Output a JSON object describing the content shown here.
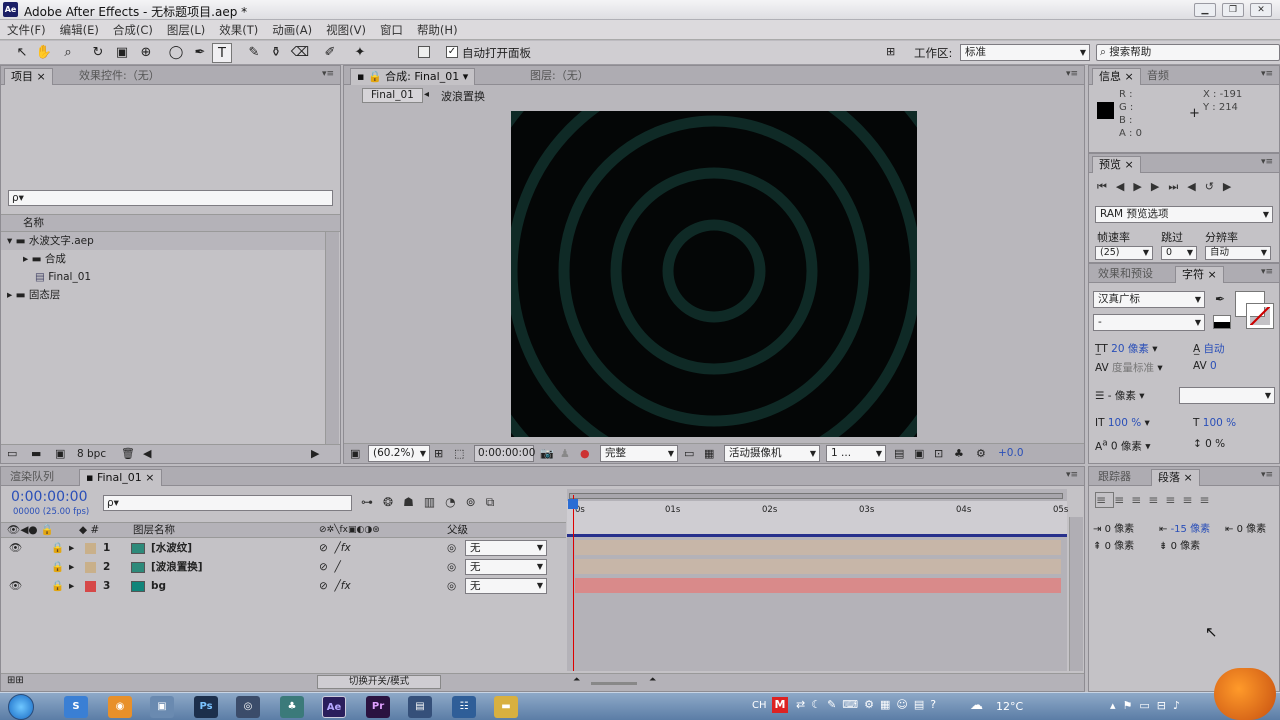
{
  "window": {
    "title": "Adobe After Effects - 无标题项目.aep *",
    "app_badge": "Ae"
  },
  "menu": [
    "文件(F)",
    "编辑(E)",
    "合成(C)",
    "图层(L)",
    "效果(T)",
    "动画(A)",
    "视图(V)",
    "窗口",
    "帮助(H)"
  ],
  "toolbar": {
    "auto_open_label": "自动打开面板",
    "workspace_label": "工作区:",
    "workspace_value": "标准",
    "search_placeholder": "搜索帮助"
  },
  "project": {
    "tab_project": "项目",
    "tab_effects": "效果控件:（无）",
    "search_placeholder": "ρ▾",
    "col_name": "名称",
    "bpc": "8 bpc",
    "items": [
      {
        "label": "水波文字.aep",
        "type": "folder"
      },
      {
        "label": "合成",
        "type": "folder"
      },
      {
        "label": "Final_01",
        "type": "comp"
      },
      {
        "label": "固态层",
        "type": "folder"
      }
    ]
  },
  "composition": {
    "tab_comp": "合成: Final_01",
    "tab_layer": "图层:（无）",
    "crumb_active": "Final_01",
    "crumb_next": "波浪置换",
    "zoom": "(60.2%)",
    "timecode": "0:00:00:00",
    "resolution": "完整",
    "camera": "活动摄像机",
    "views": "1 ...",
    "exposure": "+0.0"
  },
  "info": {
    "tab_info": "信息",
    "tab_audio": "音频",
    "r": "R :",
    "g": "G :",
    "b": "B :",
    "a": "A : 0",
    "x": "X : -191",
    "y": "Y : 214"
  },
  "preview": {
    "tab": "预览",
    "ram_option": "RAM 预览选项",
    "frame_rate_label": "帧速率",
    "skip_label": "跳过",
    "resolution_label": "分辨率",
    "frame_rate": "(25)",
    "skip": "0",
    "resolution": "自动"
  },
  "character": {
    "tab_effects": "效果和预设",
    "tab_char": "字符",
    "font": "汉真广标",
    "style": "-",
    "size": "20 像素",
    "leading": "自动",
    "kerning": "度量标准",
    "tracking": "0",
    "stroke": "- 像素",
    "v_scale": "100 %",
    "h_scale": "100 %",
    "baseline": "0 像素",
    "tsume": "0 %"
  },
  "paragraph": {
    "tab_tracker": "跟踪器",
    "tab_para": "段落",
    "indent_left": "0 像素",
    "indent_first": "-15 像素",
    "indent_right": "0 像素",
    "space_before": "0 像素",
    "space_after": "0 像素"
  },
  "timeline": {
    "tab_render": "渲染队列",
    "tab_comp": "Final_01",
    "timecode": "0:00:00:00",
    "frame_info": "00000 (25.00 fps)",
    "search_placeholder": "ρ▾",
    "col_layer_name": "图层名称",
    "col_parent": "父级",
    "toggle_label": "切换开关/模式",
    "ruler": [
      "0s",
      "01s",
      "02s",
      "03s",
      "04s",
      "05s"
    ],
    "layers": [
      {
        "num": "1",
        "name": "[水波纹]",
        "parent": "无",
        "color": "#c9b08a",
        "bar": "#c7b6a8",
        "fx": "fx"
      },
      {
        "num": "2",
        "name": "[波浪置换]",
        "parent": "无",
        "color": "#c9b08a",
        "bar": "#c7b6a8",
        "fx": ""
      },
      {
        "num": "3",
        "name": "bg",
        "parent": "无",
        "color": "#d64848",
        "bar": "#d98a8a",
        "fx": "fx"
      }
    ]
  },
  "taskbar": {
    "lang": "CH",
    "weather": "12°C"
  }
}
